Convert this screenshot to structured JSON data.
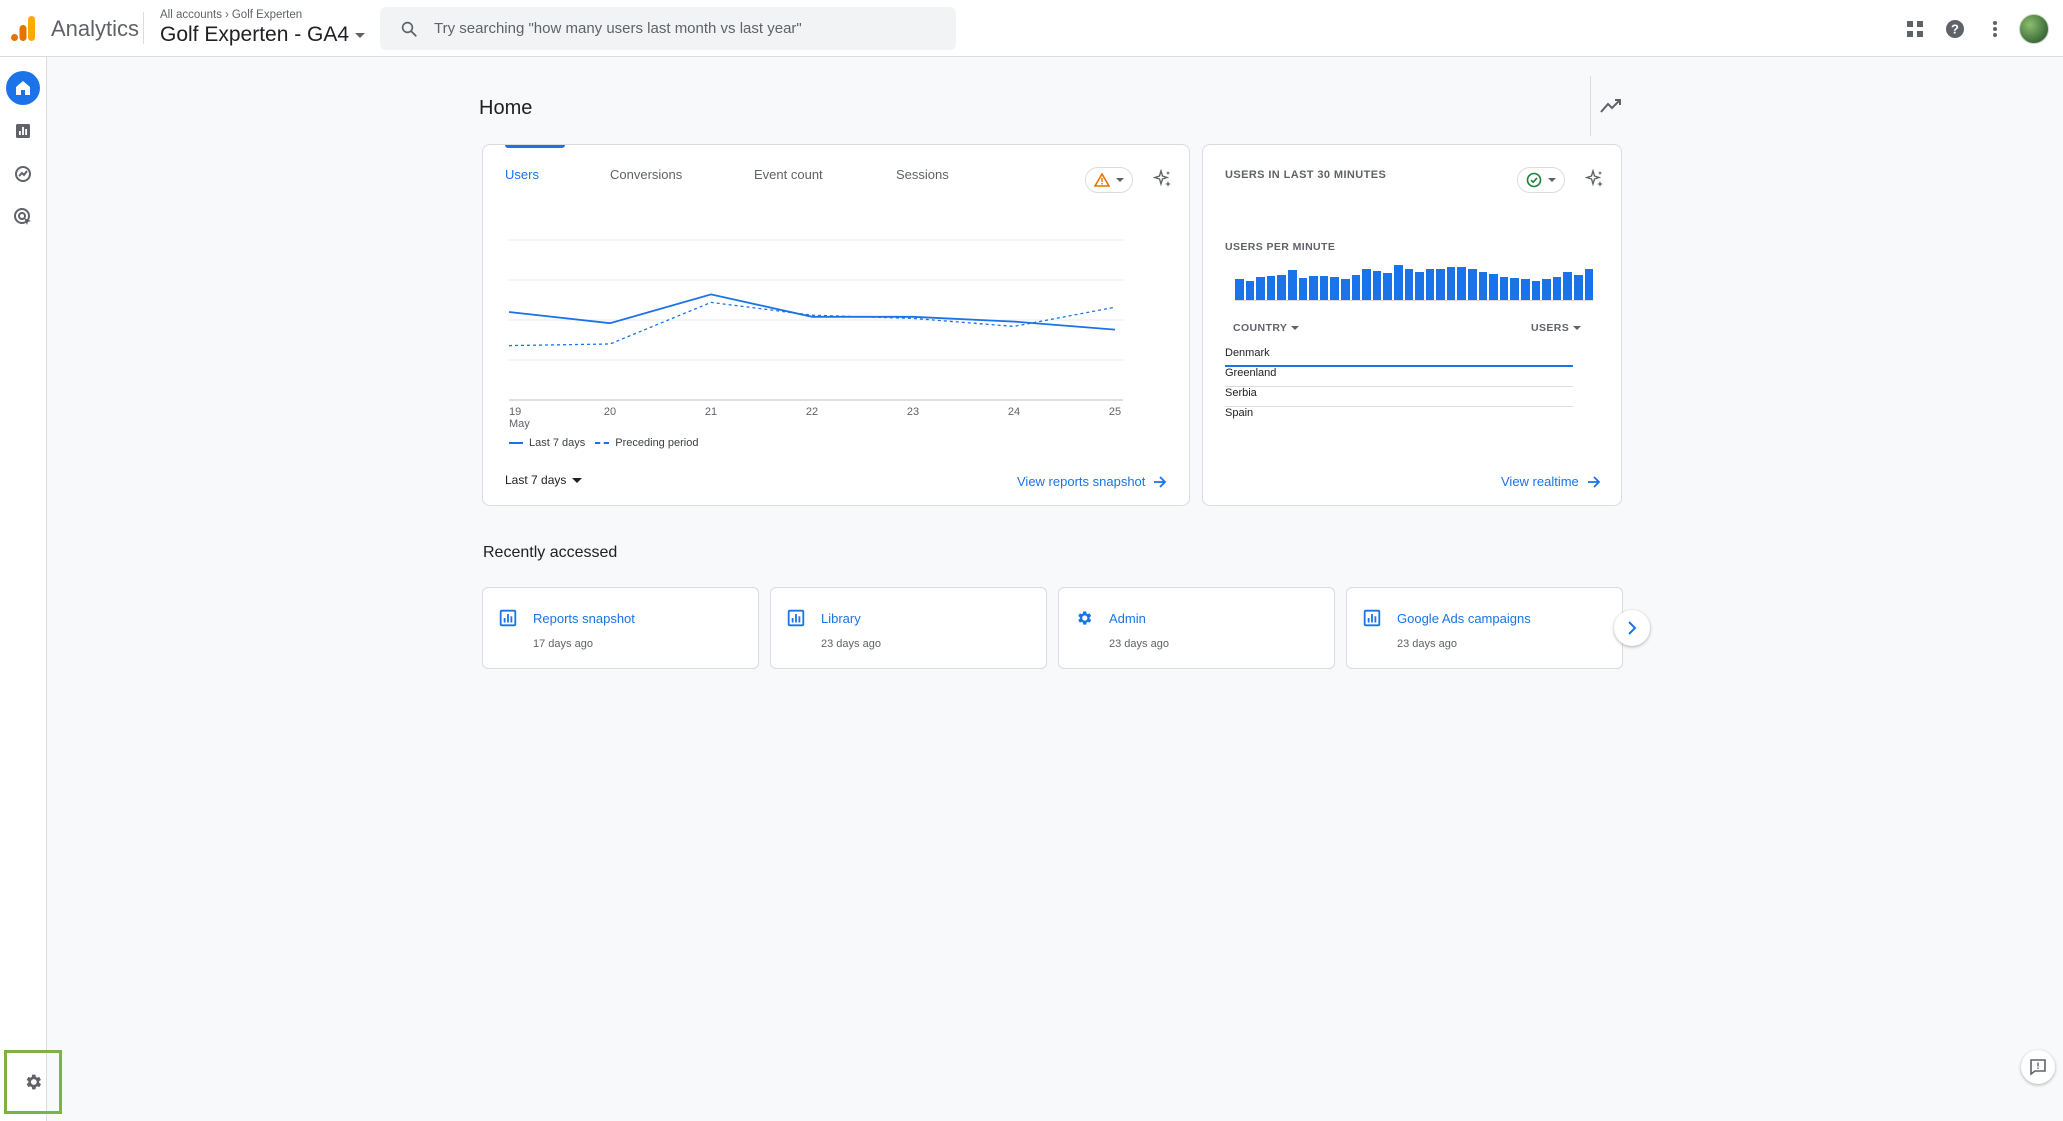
{
  "header": {
    "app_name": "Analytics",
    "breadcrumb": [
      "All accounts",
      "Golf Experten"
    ],
    "property_name": "Golf Experten - GA4",
    "search_placeholder": "Try searching \"how many users last month vs last year\""
  },
  "nav": {
    "items": [
      "home-icon",
      "reports-icon",
      "explore-icon",
      "advertising-icon"
    ],
    "active": "home",
    "settings_icon": "gear-icon"
  },
  "main": {
    "title": "Home"
  },
  "overview_card": {
    "tabs": [
      {
        "label": "Users",
        "active": true
      },
      {
        "label": "Conversions",
        "active": false
      },
      {
        "label": "Event count",
        "active": false
      },
      {
        "label": "Sessions",
        "active": false
      }
    ],
    "legend": {
      "current": "Last 7 days",
      "previous": "Preceding period"
    },
    "date_range": "Last 7 days",
    "link": "View reports snapshot"
  },
  "chart_data": {
    "type": "line",
    "x": [
      "19",
      "20",
      "21",
      "22",
      "23",
      "24",
      "25"
    ],
    "x_sublabel": "May",
    "series": [
      {
        "name": "Last 7 days",
        "style": "solid",
        "values": [
          0.55,
          0.48,
          0.66,
          0.52,
          0.52,
          0.49,
          0.44
        ]
      },
      {
        "name": "Preceding period",
        "style": "dashed",
        "values": [
          0.34,
          0.35,
          0.61,
          0.53,
          0.51,
          0.46,
          0.58
        ]
      }
    ],
    "grid": true,
    "colors": {
      "line": "#1a73e8"
    }
  },
  "realtime_card": {
    "title": "USERS IN LAST 30 MINUTES",
    "subtitle": "USERS PER MINUTE",
    "bars": [
      0.6,
      0.55,
      0.65,
      0.7,
      0.72,
      0.85,
      0.62,
      0.7,
      0.7,
      0.65,
      0.6,
      0.72,
      0.88,
      0.82,
      0.78,
      1.0,
      0.9,
      0.8,
      0.9,
      0.88,
      0.95,
      0.95,
      0.9,
      0.8,
      0.75,
      0.65,
      0.62,
      0.6,
      0.55,
      0.6,
      0.65,
      0.8,
      0.72,
      0.9
    ],
    "col_country": "COUNTRY",
    "col_users": "USERS",
    "rows": [
      {
        "country": "Denmark",
        "share": 1.0
      },
      {
        "country": "Greenland",
        "share": 0.0
      },
      {
        "country": "Serbia",
        "share": 0.0
      },
      {
        "country": "Spain",
        "share": 0.0
      }
    ],
    "link": "View realtime"
  },
  "recent": {
    "title": "Recently accessed",
    "items": [
      {
        "name": "Reports snapshot",
        "time": "17 days ago",
        "icon": "reports-icon"
      },
      {
        "name": "Library",
        "time": "23 days ago",
        "icon": "reports-icon"
      },
      {
        "name": "Admin",
        "time": "23 days ago",
        "icon": "gear-icon"
      },
      {
        "name": "Google Ads campaigns",
        "time": "23 days ago",
        "icon": "reports-icon"
      }
    ]
  }
}
